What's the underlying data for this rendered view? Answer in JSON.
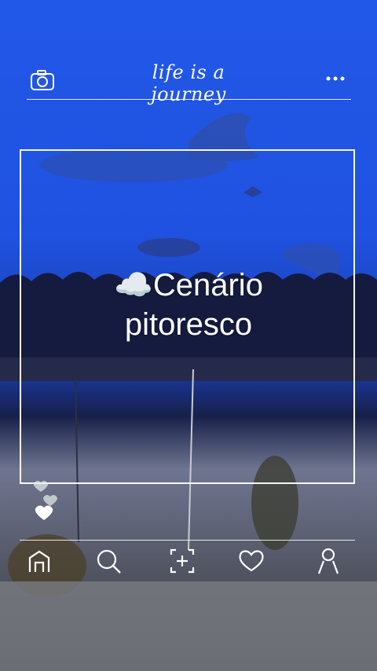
{
  "header": {
    "title": "life is a journey",
    "camera_icon": "camera-icon",
    "more_icon": "more-dots-icon"
  },
  "caption": {
    "emoji": "☁️",
    "text": "Cenário pitoresco"
  },
  "nav": {
    "items": [
      {
        "icon": "home-icon"
      },
      {
        "icon": "search-icon"
      },
      {
        "icon": "add-icon"
      },
      {
        "icon": "heart-icon"
      },
      {
        "icon": "profile-icon"
      }
    ]
  },
  "colors": {
    "overlay": "#ffffff",
    "water": "#1d4fd8",
    "deep": "#0f1f4d"
  }
}
